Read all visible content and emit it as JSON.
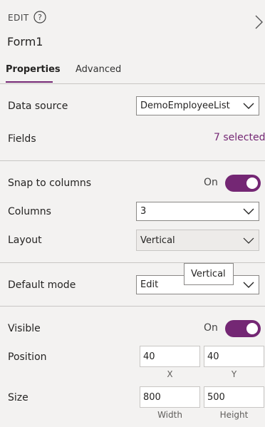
{
  "header": {
    "mode_label": "EDIT",
    "title": "Form1"
  },
  "tabs": [
    {
      "label": "Properties",
      "active": true
    },
    {
      "label": "Advanced",
      "active": false
    }
  ],
  "data_source": {
    "label": "Data source",
    "value": "DemoEmployeeList"
  },
  "fields": {
    "label": "Fields",
    "value": "7 selected"
  },
  "snap_to_columns": {
    "label": "Snap to columns",
    "state_text": "On",
    "on": true
  },
  "columns": {
    "label": "Columns",
    "value": "3"
  },
  "layout": {
    "label": "Layout",
    "value": "Vertical"
  },
  "tooltip": {
    "text": "Vertical"
  },
  "default_mode": {
    "label": "Default mode",
    "value": "Edit"
  },
  "visible": {
    "label": "Visible",
    "state_text": "On",
    "on": true
  },
  "position": {
    "label": "Position",
    "x_value": "40",
    "y_value": "40",
    "x_caption": "X",
    "y_caption": "Y"
  },
  "size": {
    "label": "Size",
    "width_value": "800",
    "height_value": "500",
    "width_caption": "Width",
    "height_caption": "Height"
  },
  "colors": {
    "accent": "#742774",
    "panel_background": "#f3f2f1"
  },
  "icons": {
    "help": "help-icon",
    "collapse": "chevron-right-icon",
    "dropdown": "chevron-down-icon"
  }
}
